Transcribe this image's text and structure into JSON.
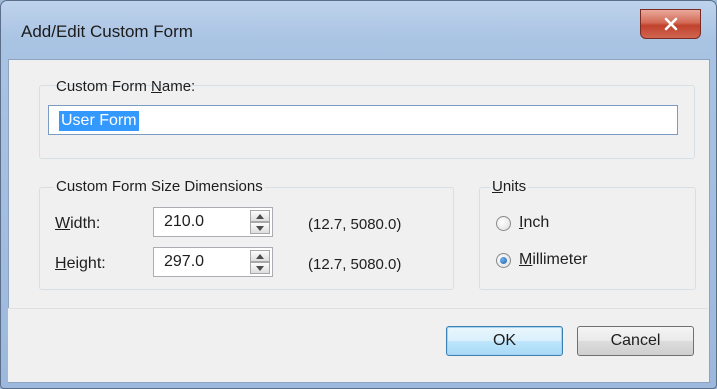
{
  "window": {
    "title": "Add/Edit Custom Form"
  },
  "name_group": {
    "label_pre": "Custom Form ",
    "label_u": "N",
    "label_post": "ame:",
    "value": "User Form"
  },
  "size_group": {
    "legend": "Custom Form Size Dimensions",
    "width": {
      "label_u": "W",
      "label_post": "idth:",
      "value": "210.0",
      "range": "(12.7, 5080.0)"
    },
    "height": {
      "label_u": "H",
      "label_post": "eight:",
      "value": "297.0",
      "range": "(12.7, 5080.0)"
    }
  },
  "units_group": {
    "legend_u": "U",
    "legend_post": "nits",
    "inch": {
      "label_u": "I",
      "label_post": "nch",
      "checked": false
    },
    "mm": {
      "label_u": "M",
      "label_post": "illimeter",
      "checked": true
    }
  },
  "buttons": {
    "ok": "OK",
    "cancel": "Cancel"
  },
  "colors": {
    "selection": "#3399ff",
    "close": "#c2412b"
  }
}
